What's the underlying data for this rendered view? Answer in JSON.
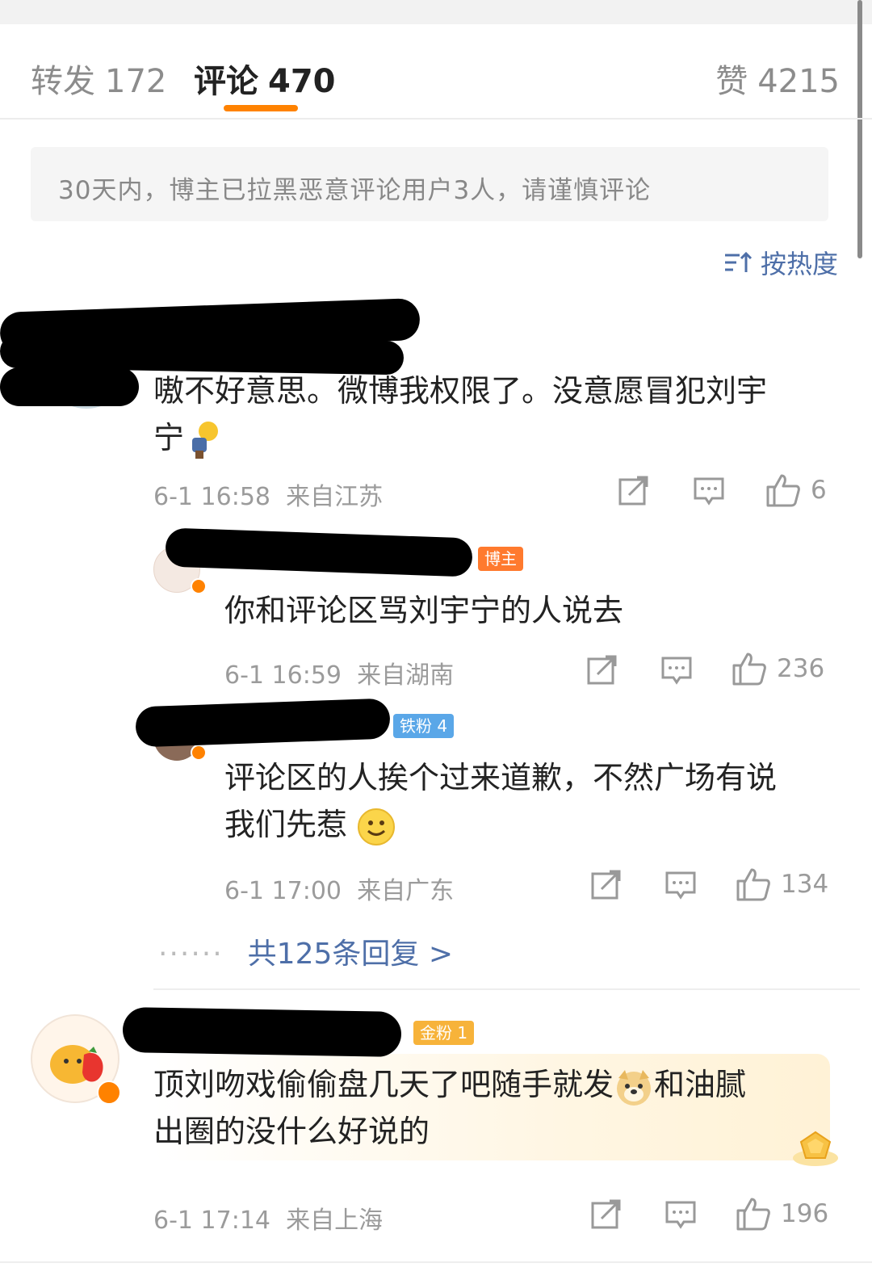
{
  "tabs": {
    "repost_label": "转发",
    "repost_count": "172",
    "comment_label": "评论",
    "comment_count": "470",
    "like_label": "赞",
    "like_count": "4215"
  },
  "notice": "30天内，博主已拉黑恶意评论用户3人，请谨慎评论",
  "sort_label": "按热度",
  "comments": [
    {
      "text_line1": "嗷不好意思。微博我权限了。没意愿冒犯刘宇",
      "text_line2": "宁",
      "time": "6-1 16:58",
      "location": "来自江苏",
      "likes": "6",
      "replies": [
        {
          "badge": "博主",
          "text": "你和评论区骂刘宇宁的人说去",
          "time": "6-1 16:59",
          "location": "来自湖南",
          "likes": "236"
        },
        {
          "badge": "铁粉 4",
          "text_line1": "评论区的人挨个过来道歉，不然广场有说",
          "text_line2": "我们先惹",
          "time": "6-1 17:00",
          "location": "来自广东",
          "likes": "134"
        }
      ],
      "more_replies": "共125条回复 >"
    },
    {
      "badge": "金粉 1",
      "text_line1_a": "顶刘吻戏偷偷盘几天了吧随手就发",
      "text_line1_b": "和油腻",
      "text_line2": "出圈的没什么好说的",
      "time": "6-1 17:14",
      "location": "来自上海",
      "likes": "196"
    }
  ],
  "colors": {
    "accent": "#ff8200",
    "link": "#4e6fa8",
    "meta": "#9b9b9b"
  }
}
